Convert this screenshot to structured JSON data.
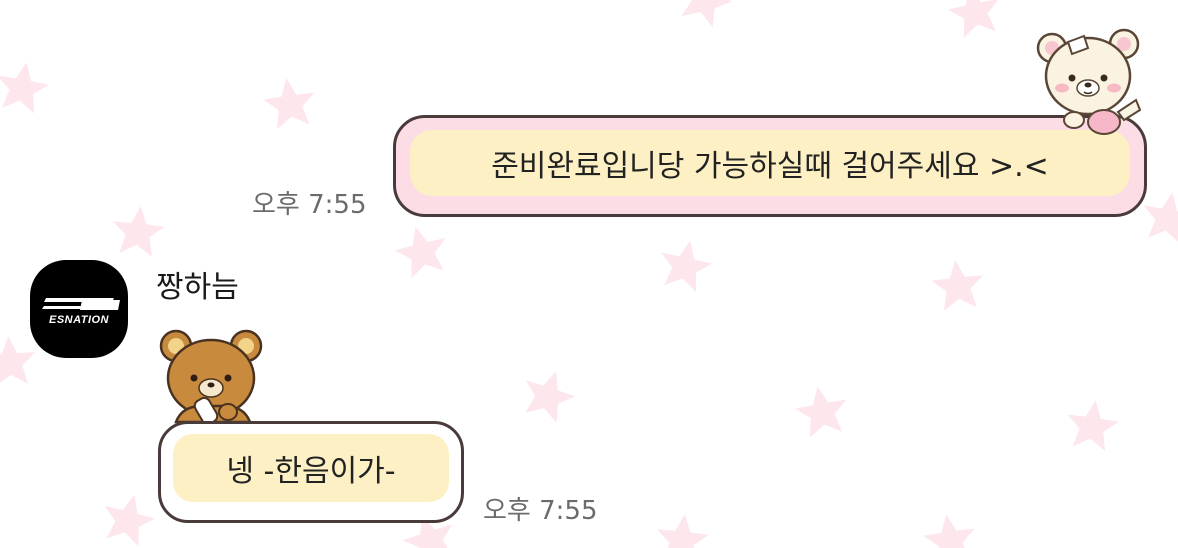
{
  "messages": {
    "outgoing": {
      "text": "준비완료입니당 가능하실때 걸어주세요 >.<",
      "time": "오후 7:55",
      "sticker": "white-bear-sticker-icon"
    },
    "incoming": {
      "sender_name": "짱하늠",
      "avatar_logo_text": "ESNATION",
      "text": "넹 -한음이가-",
      "time": "오후 7:55",
      "sticker": "brown-bear-sticker-icon"
    }
  },
  "colors": {
    "background": "#ffffff",
    "star": "#fde6ec",
    "bubble_fill": "#fdf0c4",
    "outgoing_frame": "#fcdde6",
    "bubble_border": "#4a3b3b",
    "time_text": "#6b6b6b"
  }
}
